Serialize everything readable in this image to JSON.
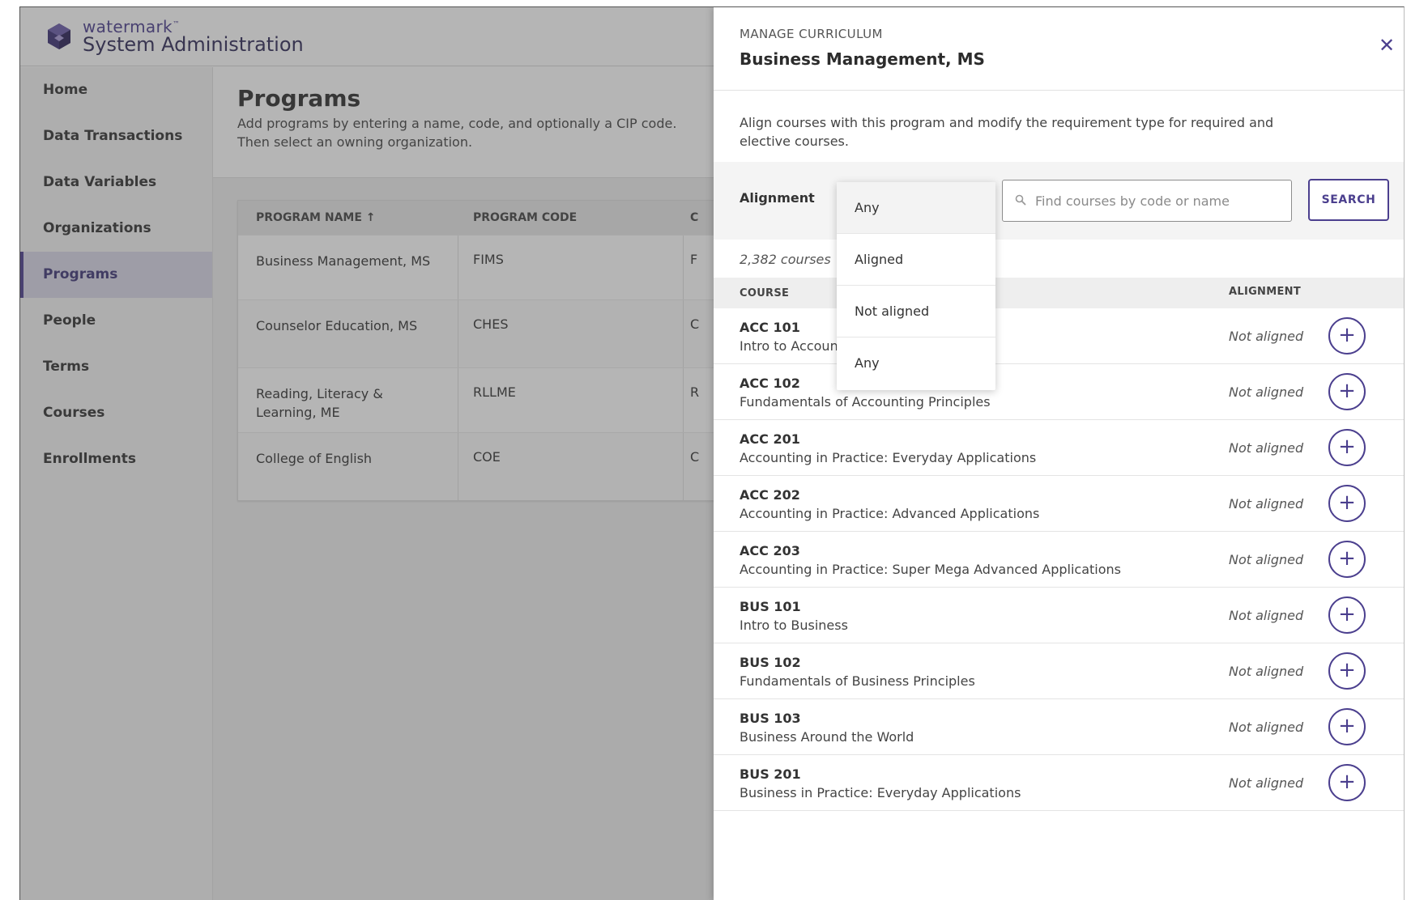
{
  "brand": {
    "small": "watermark",
    "tm": "™",
    "title": "System Administration"
  },
  "sidebar": {
    "items": [
      {
        "label": "Home"
      },
      {
        "label": "Data Transactions"
      },
      {
        "label": "Data Variables"
      },
      {
        "label": "Organizations"
      },
      {
        "label": "Programs"
      },
      {
        "label": "People"
      },
      {
        "label": "Terms"
      },
      {
        "label": "Courses"
      },
      {
        "label": "Enrollments"
      }
    ],
    "active": "Programs"
  },
  "programs_page": {
    "title": "Programs",
    "description": "Add programs by entering a name, code, and optionally a CIP code. Then select an owning organization.",
    "table": {
      "columns": [
        "PROGRAM NAME ↑",
        "PROGRAM CODE",
        "C"
      ],
      "rows": [
        {
          "name": "Business Management, MS",
          "code": "FIMS",
          "extra": "F"
        },
        {
          "name": "Counselor Education, MS",
          "code": "CHES",
          "extra": "C"
        },
        {
          "name": "Reading, Literacy & Learning, ME",
          "code": "RLLME",
          "extra": "R"
        },
        {
          "name": "College of English",
          "code": "COE",
          "extra": "C"
        }
      ]
    }
  },
  "panel": {
    "eyebrow": "MANAGE CURRICULUM",
    "title": "Business Management, MS",
    "close_glyph": "✕",
    "description": "Align courses with this program and modify the requirement type for required and elective courses.",
    "filter": {
      "alignment_label": "Alignment",
      "search_placeholder": "Find courses by code or name",
      "search_value": "",
      "search_button": "SEARCH"
    },
    "course_count": "2,382 courses",
    "list_headers": {
      "course": "COURSE",
      "alignment": "ALIGNMENT"
    },
    "courses": [
      {
        "code": "ACC 101",
        "name": "Intro to Accounting",
        "status": "Not aligned"
      },
      {
        "code": "ACC 102",
        "name": "Fundamentals of Accounting Principles",
        "status": "Not aligned"
      },
      {
        "code": "ACC 201",
        "name": "Accounting in Practice: Everyday Applications",
        "status": "Not aligned"
      },
      {
        "code": "ACC 202",
        "name": "Accounting in Practice: Advanced Applications",
        "status": "Not aligned"
      },
      {
        "code": "ACC 203",
        "name": "Accounting in Practice: Super Mega Advanced Applications",
        "status": "Not aligned"
      },
      {
        "code": "BUS 101",
        "name": "Intro to Business",
        "status": "Not aligned"
      },
      {
        "code": "BUS 102",
        "name": "Fundamentals of Business Principles",
        "status": "Not aligned"
      },
      {
        "code": "BUS 103",
        "name": "Business Around the World",
        "status": "Not aligned"
      },
      {
        "code": "BUS 201",
        "name": "Business in Practice: Everyday Applications",
        "status": "Not aligned"
      }
    ],
    "add_glyph": "+"
  },
  "dropdown": {
    "options": [
      "Any",
      "Aligned",
      "Not aligned",
      "Any"
    ],
    "selected_index": 0
  },
  "colors": {
    "accent": "#4b3f8e",
    "scrim": "rgba(70,70,70,0.40)"
  }
}
